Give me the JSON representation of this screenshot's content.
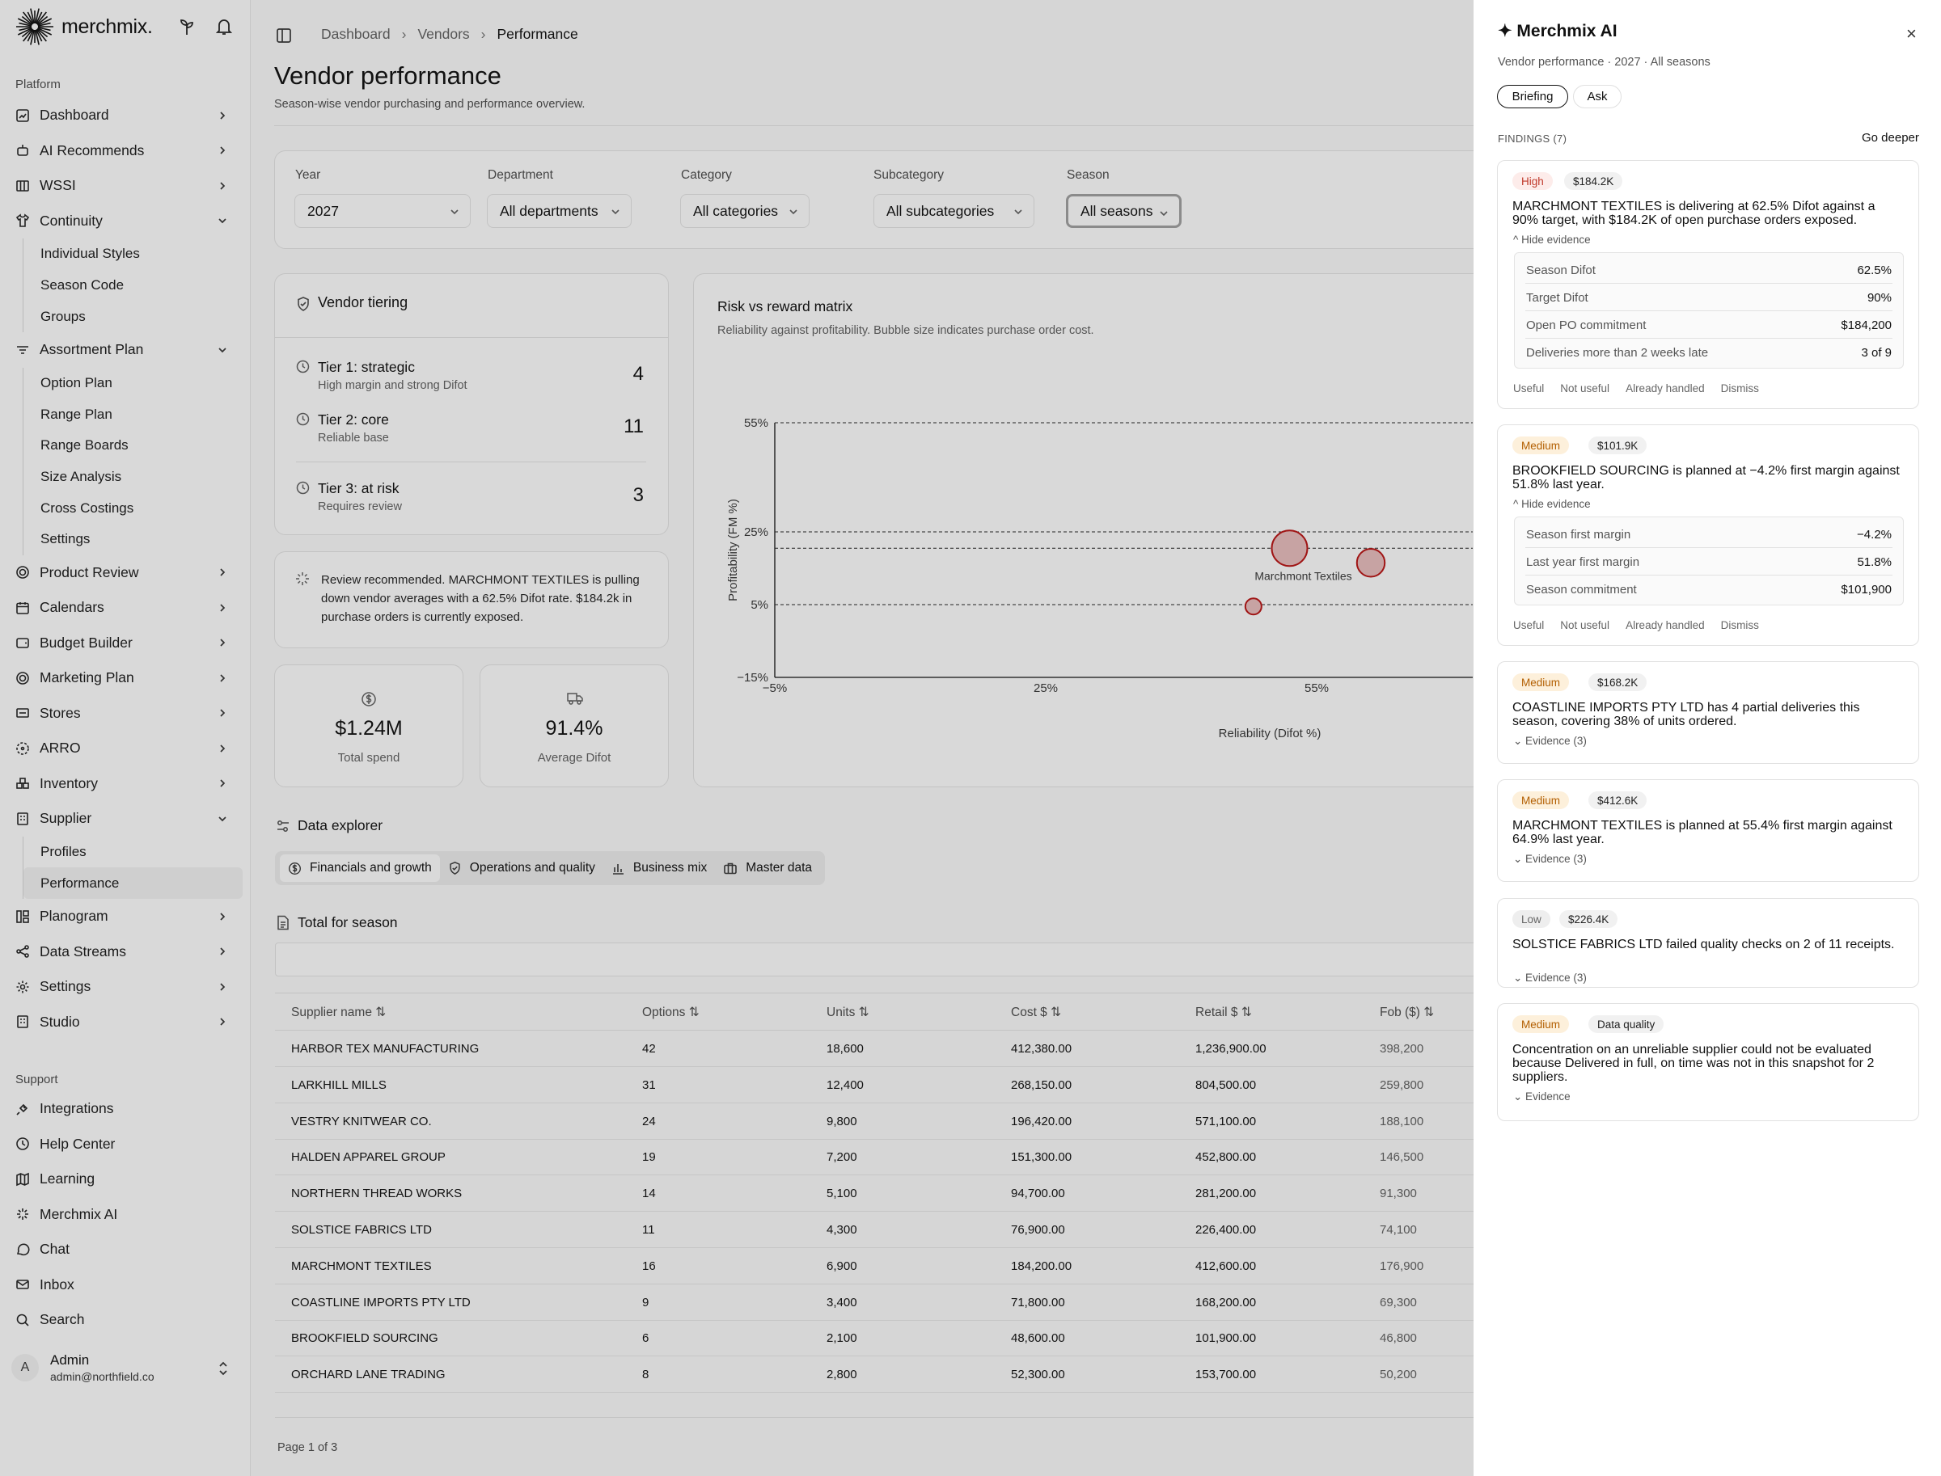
{
  "app": {
    "brand": "merchmix."
  },
  "sidebar": {
    "platform_label": "Platform",
    "support_label": "Support",
    "items": [
      {
        "label": "Dashboard",
        "icon": "dashboard-icon"
      },
      {
        "label": "AI Recommends",
        "icon": "robot-icon"
      },
      {
        "label": "WSSI",
        "icon": "grid-icon"
      },
      {
        "label": "Continuity",
        "icon": "shirt-icon",
        "children": [
          "Individual Styles",
          "Season Code",
          "Groups"
        ]
      },
      {
        "label": "Assortment Plan",
        "icon": "list-filter-icon",
        "children": [
          "Option Plan",
          "Range Plan",
          "Range Boards",
          "Size Analysis",
          "Cross Costings",
          "Settings"
        ]
      },
      {
        "label": "Product Review",
        "icon": "target-icon"
      },
      {
        "label": "Calendars",
        "icon": "calendar-icon"
      },
      {
        "label": "Budget Builder",
        "icon": "wallet-icon"
      },
      {
        "label": "Marketing Plan",
        "icon": "target-icon"
      },
      {
        "label": "Stores",
        "icon": "store-icon"
      },
      {
        "label": "ARRO",
        "icon": "dashed-circle-icon"
      },
      {
        "label": "Inventory",
        "icon": "boxes-icon"
      },
      {
        "label": "Supplier",
        "icon": "building-icon",
        "children": [
          "Profiles",
          "Performance"
        ]
      },
      {
        "label": "Planogram",
        "icon": "layout-icon"
      },
      {
        "label": "Data Streams",
        "icon": "share-icon"
      },
      {
        "label": "Settings",
        "icon": "gear-icon"
      },
      {
        "label": "Studio",
        "icon": "building-icon"
      }
    ],
    "support_items": [
      {
        "label": "Integrations",
        "icon": "plug-icon"
      },
      {
        "label": "Help Center",
        "icon": "clock-icon"
      },
      {
        "label": "Learning",
        "icon": "map-icon"
      },
      {
        "label": "Merchmix AI",
        "icon": "sparkle-icon"
      },
      {
        "label": "Chat",
        "icon": "chat-icon"
      },
      {
        "label": "Inbox",
        "icon": "mail-icon"
      },
      {
        "label": "Search",
        "icon": "search-icon"
      }
    ],
    "user": {
      "initial": "A",
      "name": "Admin",
      "email": "admin@northfield.co"
    }
  },
  "breadcrumb": [
    "Dashboard",
    "Vendors",
    "Performance"
  ],
  "page": {
    "title": "Vendor performance",
    "subtitle": "Season-wise vendor purchasing and performance overview."
  },
  "filters": [
    {
      "label": "Year",
      "value": "2027"
    },
    {
      "label": "Department",
      "value": "All departments"
    },
    {
      "label": "Category",
      "value": "All categories"
    },
    {
      "label": "Subcategory",
      "value": "All subcategories"
    },
    {
      "label": "Season",
      "value": "All seasons"
    }
  ],
  "tiering": {
    "title": "Vendor tiering",
    "tiers": [
      {
        "title": "Tier 1: strategic",
        "desc": "High margin and strong Difot",
        "count": "4"
      },
      {
        "title": "Tier 2: core",
        "desc": "Reliable base",
        "count": "11"
      },
      {
        "title": "Tier 3: at risk",
        "desc": "Requires review",
        "count": "3"
      }
    ]
  },
  "recommendation": {
    "text": "Review recommended. MARCHMONT TEXTILES is pulling down vendor averages with a 62.5% Difot rate. $184.2k in purchase orders is currently exposed."
  },
  "kpis": [
    {
      "value": "$1.24M",
      "label": "Total spend",
      "icon": "dollar-icon"
    },
    {
      "value": "91.4%",
      "label": "Average Difot",
      "icon": "truck-icon"
    }
  ],
  "matrix": {
    "title": "Risk vs reward matrix",
    "subtitle": "Reliability against profitability. Bubble size indicates purchase order cost.",
    "ylabel": "Profitability (FM %)",
    "xlabel": "Reliability (Difot %)",
    "bubble_label": "Marchmont Textiles"
  },
  "chart_data": {
    "type": "scatter",
    "title": "Risk vs reward matrix",
    "xlabel": "Reliability (Difot %)",
    "ylabel": "Profitability (FM %)",
    "xlim": [
      -5,
      85
    ],
    "ylim": [
      -15,
      55
    ],
    "x_ticks": [
      "−5%",
      "25%",
      "55%"
    ],
    "y_ticks": [
      "55%",
      "25%",
      "5%",
      "−15%"
    ],
    "reference_lines_y": [
      55,
      25,
      20.5,
      5
    ],
    "points": [
      {
        "label": "Marchmont Textiles",
        "x": 52,
        "y": 20.5,
        "size": 184200
      },
      {
        "label": "",
        "x": 61,
        "y": 16.5,
        "size": 101900
      },
      {
        "label": "",
        "x": 48,
        "y": 4.5,
        "size": 48600
      }
    ]
  },
  "explorer": {
    "title": "Data explorer",
    "tabs": [
      "Financials and growth",
      "Operations and quality",
      "Business mix",
      "Master data"
    ],
    "active_tab": "Financials and growth",
    "section_title": "Total for season"
  },
  "table": {
    "columns": [
      "Supplier name",
      "Options",
      "Units",
      "Cost $",
      "Retail $",
      "Fob ($)"
    ],
    "rows": [
      [
        "HARBOR TEX MANUFACTURING",
        "42",
        "18,600",
        "412,380.00",
        "1,236,900.00",
        "398,200"
      ],
      [
        "LARKHILL MILLS",
        "31",
        "12,400",
        "268,150.00",
        "804,500.00",
        "259,800"
      ],
      [
        "VESTRY KNITWEAR CO.",
        "24",
        "9,800",
        "196,420.00",
        "571,100.00",
        "188,100"
      ],
      [
        "HALDEN APPAREL GROUP",
        "19",
        "7,200",
        "151,300.00",
        "452,800.00",
        "146,500"
      ],
      [
        "NORTHERN THREAD WORKS",
        "14",
        "5,100",
        "94,700.00",
        "281,200.00",
        "91,300"
      ],
      [
        "SOLSTICE FABRICS LTD",
        "11",
        "4,300",
        "76,900.00",
        "226,400.00",
        "74,100"
      ],
      [
        "MARCHMONT TEXTILES",
        "16",
        "6,900",
        "184,200.00",
        "412,600.00",
        "176,900"
      ],
      [
        "COASTLINE IMPORTS PTY LTD",
        "9",
        "3,400",
        "71,800.00",
        "168,200.00",
        "69,300"
      ],
      [
        "BROOKFIELD SOURCING",
        "6",
        "2,100",
        "48,600.00",
        "101,900.00",
        "46,800"
      ],
      [
        "ORCHARD LANE TRADING",
        "8",
        "2,800",
        "52,300.00",
        "153,700.00",
        "50,200"
      ]
    ],
    "pagination": "Page 1 of 3"
  },
  "ai": {
    "title": "✦ Merchmix AI",
    "subtitle": "Vendor performance · 2027 · All seasons",
    "pills": [
      "Briefing",
      "Ask"
    ],
    "findings_label": "FINDINGS (7)",
    "go_deeper": "Go deeper",
    "actions": [
      "Useful",
      "Not useful",
      "Already handled",
      "Dismiss"
    ],
    "findings": [
      {
        "severity": "High",
        "amount": "$184.2K",
        "text": "MARCHMONT TEXTILES is delivering at 62.5% Difot against a 90% target, with $184.2K of open purchase orders exposed.",
        "toggle": "^ Hide evidence",
        "evidence": [
          [
            "Season Difot",
            "62.5%"
          ],
          [
            "Target Difot",
            "90%"
          ],
          [
            "Open PO commitment",
            "$184,200"
          ],
          [
            "Deliveries more than 2 weeks late",
            "3 of 9"
          ]
        ]
      },
      {
        "severity": "Medium",
        "amount": "$101.9K",
        "text": "BROOKFIELD SOURCING is planned at −4.2% first margin against 51.8% last year.",
        "toggle": "^ Hide evidence",
        "evidence": [
          [
            "Season first margin",
            "−4.2%"
          ],
          [
            "Last year first margin",
            "51.8%"
          ],
          [
            "Season commitment",
            "$101,900"
          ]
        ]
      },
      {
        "severity": "Medium",
        "amount": "$168.2K",
        "text": "COASTLINE IMPORTS PTY LTD has 4 partial deliveries this season, covering 38% of units ordered.",
        "toggle": "⌄ Evidence (3)"
      },
      {
        "severity": "Medium",
        "amount": "$412.6K",
        "text": "MARCHMONT TEXTILES is planned at 55.4% first margin against 64.9% last year.",
        "toggle": "⌄ Evidence (3)"
      },
      {
        "severity": "Low",
        "amount": "$226.4K",
        "text": "SOLSTICE FABRICS LTD failed quality checks on 2 of 11 receipts.",
        "toggle": "⌄ Evidence (3)"
      },
      {
        "severity": "Medium",
        "amount": "Data quality",
        "text": "Concentration on an unreliable supplier could not be evaluated because Delivered in full, on time was not in this snapshot for 2 suppliers.",
        "toggle": "⌄ Evidence"
      }
    ]
  }
}
